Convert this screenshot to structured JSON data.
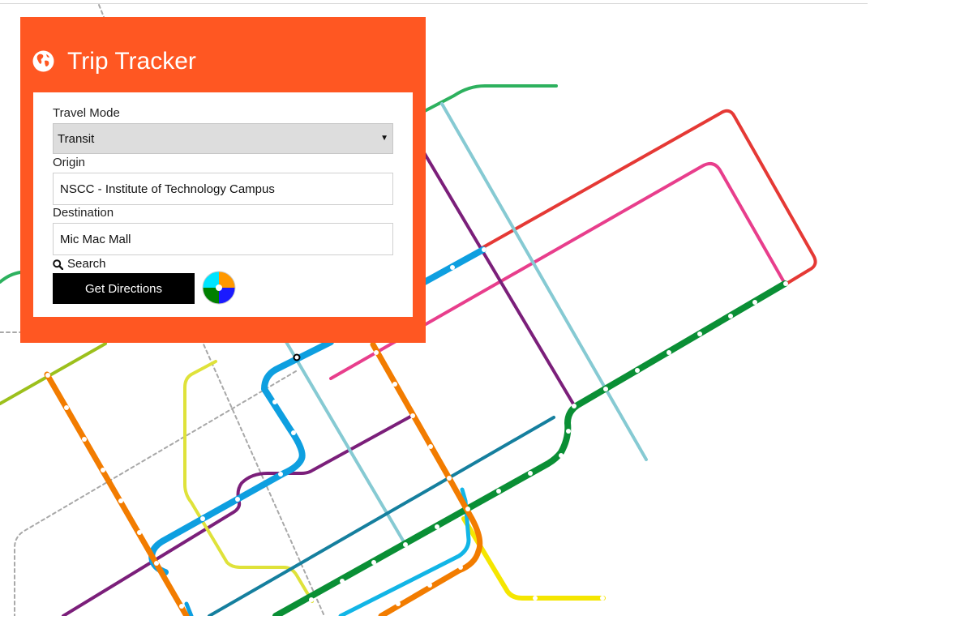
{
  "app": {
    "title": "Trip Tracker",
    "header_icon": "globe-icon",
    "brand_color": "#ff5722"
  },
  "form": {
    "travel_mode": {
      "label": "Travel Mode",
      "selected": "Transit"
    },
    "origin": {
      "label": "Origin",
      "value": "NSCC - Institute of Technology Campus"
    },
    "destination": {
      "label": "Destination",
      "value": "Mic Mac Mall"
    },
    "search": {
      "icon": "search-icon",
      "label": "Search"
    },
    "directions_button": {
      "label": "Get Directions"
    },
    "loading_indicator": {
      "icon": "spinner-icon",
      "colors": [
        "#00e5ff",
        "#ff9800",
        "#1a1aff",
        "#008000"
      ]
    }
  },
  "map": {
    "line_colors": {
      "red": "#e53935",
      "magenta": "#e83e8c",
      "purple": "#7b1f7a",
      "light_teal": "#86cad3",
      "green": "#0a8f35",
      "orange": "#f27c00",
      "blue": "#0e9fe0",
      "yellow": "#f5e600",
      "olive_yellow": "#dfe23a",
      "lime": "#9cc01c",
      "dark_teal": "#157f9e",
      "emerald": "#2db15e",
      "cyan": "#12b5e6",
      "gray_dashed": "#a8a8a8"
    }
  }
}
